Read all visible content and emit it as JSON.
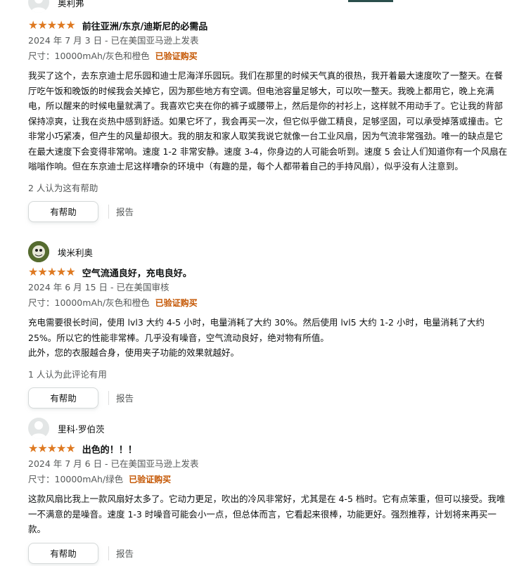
{
  "reviews": [
    {
      "author": "奥利弗",
      "avatar_icon": "default-user-icon",
      "rating": 5,
      "title": "前往亚洲/东京/迪斯尼的必需品",
      "date": "2024 年 7 月 3 日 - 已在美国亚马逊上发表",
      "variant": "尺寸：10000mAh/灰色和橙色",
      "verified": "已验证购买",
      "body": "我买了这个，去东京迪士尼乐园和迪士尼海洋乐园玩。我们在那里的时候天气真的很热，我开着最大速度吹了一整天。在餐厅吃午饭和晚饭的时候我会关掉它，因为那些地方有空调。但电池容量足够大，可以吹一整天。我晚上都用它，晚上充满电，所以醒来的时候电量就满了。我喜欢它夹在你的裤子或腰带上，然后是你的衬衫上，这样就不用动手了。它让我的背部保持凉爽，让我在炎热中感到舒适。如果它坏了，我会再买一次，但它似乎做工精良，足够坚固，可以承受掉落或撞击。它非常小巧紧凑，但产生的风量却很大。我的朋友和家人取笑我说它就像一台工业风扇，因为气流非常强劲。唯一的缺点是它在最大速度下会变得非常响。速度 1-2 非常安静。速度 3-4，你身边的人可能会听到。速度 5 会让人们知道你有一个风扇在嗡嗡作响。但在东京迪士尼这样嘈杂的环境中（有趣的是，每个人都带着自己的手持风扇），似乎没有人注意到。",
      "helpful": "2 人认为这有帮助",
      "button": "有帮助",
      "report": "报告"
    },
    {
      "author": "埃米利奥",
      "avatar_icon": "custom-photo-avatar",
      "rating": 5,
      "title": "空气流通良好，充电良好。",
      "date": "2024 年 6 月 15 日 - 已在美国审核",
      "variant": "尺寸：10000mAh/灰色和橙色",
      "verified": "已验证购买",
      "body": "充电需要很长时间，使用 lvl3 大约 4-5 小时，电量消耗了大约 30%。然后使用 lvl5 大约 1-2 小时，电量消耗了大约 25%。所以它的性能非常棒。几乎没有噪音，空气流动良好，绝对物有所值。\n此外，您的衣服越合身，使用夹子功能的效果就越好。",
      "helpful": "1 人认为此评论有用",
      "button": "有帮助",
      "report": "报告"
    },
    {
      "author": "里科·罗伯茨",
      "avatar_icon": "default-user-icon",
      "rating": 5,
      "title": "出色的！！！",
      "date": "2024 年 7 月 6 日 - 已在美国亚马逊上发表",
      "variant": "尺寸：10000mAh/绿色",
      "verified": "已验证购买",
      "body": "这款风扇比我上一款风扇好太多了。它动力更足，吹出的冷风非常好，尤其是在 4-5 档时。它有点笨重，但可以接受。我唯一不满意的是噪音。速度 1-3 时噪音可能会小一点，但总体而言，它看起来很棒，功能更好。强烈推荐，计划将来再买一款。",
      "helpful": "",
      "button": "有帮助",
      "report": "报告"
    }
  ],
  "colors": {
    "star": "#de7921",
    "verified": "#c45500",
    "meta": "#565959"
  }
}
